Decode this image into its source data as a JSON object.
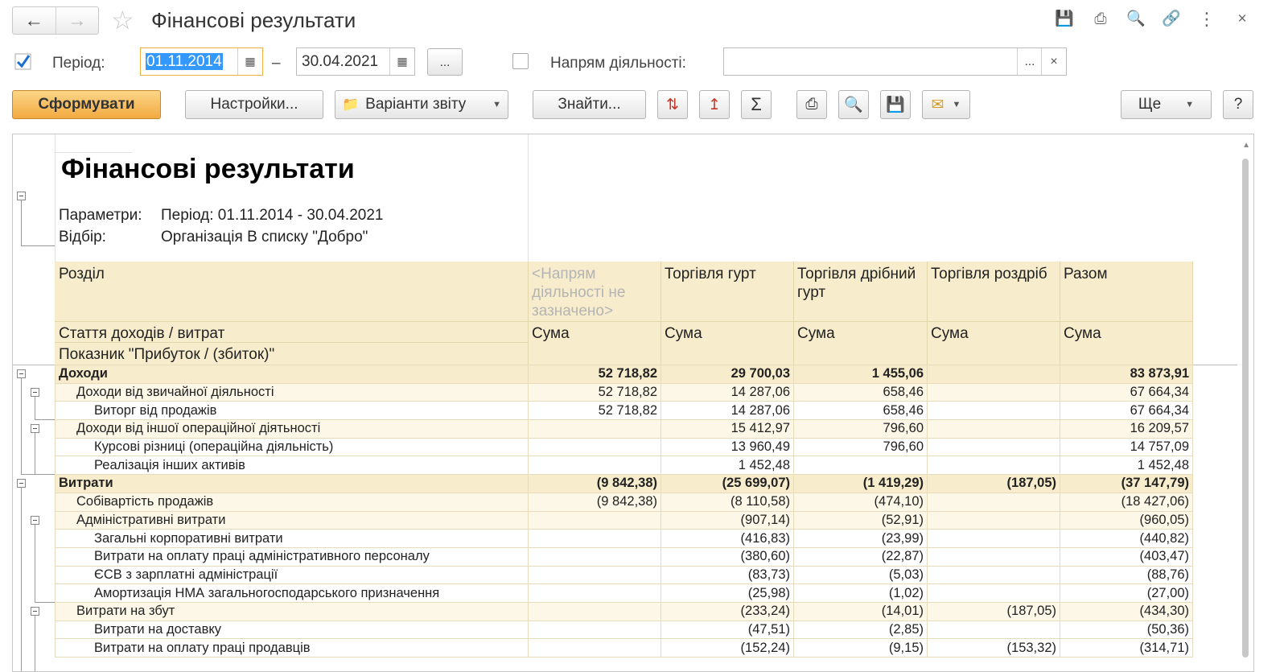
{
  "window": {
    "title": "Фінансові результати"
  },
  "filters": {
    "period_label": "Період:",
    "date_from": "01.11.2014",
    "dash": "–",
    "date_to": "30.04.2021",
    "period_button": "...",
    "activity_label": "Напрям діяльності:",
    "activity_value": "",
    "select_button": "...",
    "clear_button": "×"
  },
  "toolbar": {
    "generate": "Сформувати",
    "settings": "Настройки...",
    "variants": "Варіанти звіту",
    "find": "Знайти...",
    "more": "Ще",
    "help": "?"
  },
  "report": {
    "title": "Фінансові результати",
    "params_label": "Параметри:",
    "params_value": "Період: 01.11.2014 - 30.04.2021",
    "filter_label": "Відбір:",
    "filter_value": "Організація В списку \"Добро\"",
    "header": {
      "section": "Розділ",
      "article": "Стаття доходів / витрат",
      "indicator": "Показник \"Прибуток / (збиток)\"",
      "columns": [
        {
          "name": "<Напрям діяльності не зазначено>",
          "sub": "Сума"
        },
        {
          "name": "Торгівля гурт",
          "sub": "Сума"
        },
        {
          "name": "Торгівля дрібний гурт",
          "sub": "Сума"
        },
        {
          "name": "Торгівля роздріб",
          "sub": "Сума"
        },
        {
          "name": "Разом",
          "sub": "Сума"
        }
      ]
    },
    "rows": [
      {
        "label": "Доходи",
        "level": 0,
        "values": [
          "52 718,82",
          "29 700,03",
          "1 455,06",
          "",
          "83 873,91"
        ]
      },
      {
        "label": "Доходи від звичайної діяльності",
        "level": 1,
        "values": [
          "52 718,82",
          "14 287,06",
          "658,46",
          "",
          "67 664,34"
        ]
      },
      {
        "label": "Виторг від продажів",
        "level": 2,
        "values": [
          "52 718,82",
          "14 287,06",
          "658,46",
          "",
          "67 664,34"
        ]
      },
      {
        "label": "Доходи від іншої операційної діятьності",
        "level": 1,
        "values": [
          "",
          "15 412,97",
          "796,60",
          "",
          "16 209,57"
        ]
      },
      {
        "label": "Курсові різниці (операційна діяльність)",
        "level": 2,
        "values": [
          "",
          "13 960,49",
          "796,60",
          "",
          "14 757,09"
        ]
      },
      {
        "label": "Реалізація інших активів",
        "level": 2,
        "values": [
          "",
          "1 452,48",
          "",
          "",
          "1 452,48"
        ]
      },
      {
        "label": "Витрати",
        "level": 0,
        "values": [
          "(9 842,38)",
          "(25 699,07)",
          "(1 419,29)",
          "(187,05)",
          "(37 147,79)"
        ]
      },
      {
        "label": "Собівартість продажів",
        "level": 1,
        "values": [
          "(9 842,38)",
          "(8 110,58)",
          "(474,10)",
          "",
          "(18 427,06)"
        ]
      },
      {
        "label": "Адміністративні витрати",
        "level": 1,
        "values": [
          "",
          "(907,14)",
          "(52,91)",
          "",
          "(960,05)"
        ]
      },
      {
        "label": "Загальні корпоративні витрати",
        "level": 2,
        "values": [
          "",
          "(416,83)",
          "(23,99)",
          "",
          "(440,82)"
        ]
      },
      {
        "label": "Витрати на оплату праці адміністративного персоналу",
        "level": 2,
        "values": [
          "",
          "(380,60)",
          "(22,87)",
          "",
          "(403,47)"
        ]
      },
      {
        "label": "ЄСВ з зарплатні адміністрації",
        "level": 2,
        "values": [
          "",
          "(83,73)",
          "(5,03)",
          "",
          "(88,76)"
        ]
      },
      {
        "label": "Амортизація НМА загальногосподарського призначення",
        "level": 2,
        "values": [
          "",
          "(25,98)",
          "(1,02)",
          "",
          "(27,00)"
        ]
      },
      {
        "label": "Витрати на збут",
        "level": 1,
        "values": [
          "",
          "(233,24)",
          "(14,01)",
          "(187,05)",
          "(434,30)"
        ]
      },
      {
        "label": "Витрати на доставку",
        "level": 2,
        "values": [
          "",
          "(47,51)",
          "(2,85)",
          "",
          "(50,36)"
        ]
      },
      {
        "label": "Витрати на оплату праці продавців",
        "level": 2,
        "values": [
          "",
          "(152,24)",
          "(9,15)",
          "(153,32)",
          "(314,71)"
        ]
      }
    ]
  }
}
